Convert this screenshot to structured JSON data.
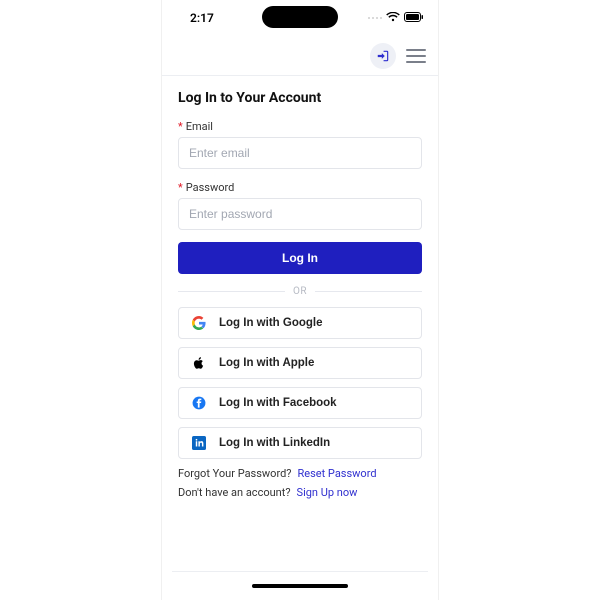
{
  "status": {
    "time": "2:17"
  },
  "nav": {
    "login_icon": "login-icon",
    "menu_icon": "hamburger-icon"
  },
  "page": {
    "title": "Log In to Your Account"
  },
  "form": {
    "email_label": "Email",
    "email_placeholder": "Enter email",
    "email_value": "",
    "password_label": "Password",
    "password_placeholder": "Enter password",
    "password_value": "",
    "required_mark": "*",
    "submit_label": "Log In",
    "divider_label": "OR"
  },
  "social": {
    "google": "Log In with Google",
    "apple": "Log In with Apple",
    "facebook": "Log In with Facebook",
    "linkedin": "Log In with LinkedIn"
  },
  "aux": {
    "forgot_text": "Forgot Your Password?",
    "forgot_link": "Reset Password",
    "signup_text": "Don't have an account?",
    "signup_link": "Sign Up now"
  }
}
